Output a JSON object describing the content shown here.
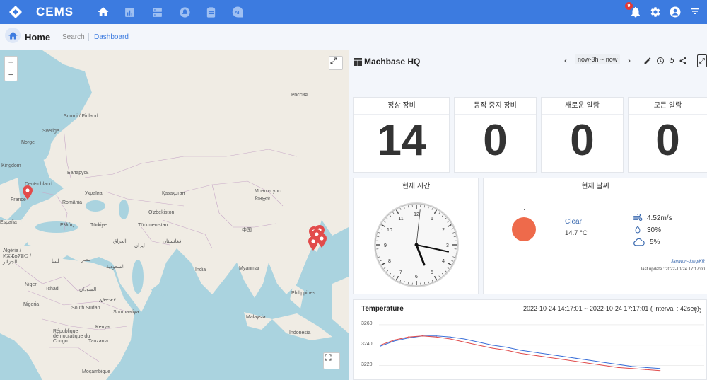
{
  "app": {
    "logo_text": "CEMS",
    "notification_count": "9"
  },
  "breadcrumb": {
    "home": "Home",
    "search": "Search",
    "dashboard": "Dashboard"
  },
  "map": {
    "zoom_in": "+",
    "zoom_out": "−",
    "labels": {
      "russia": "Россия",
      "suomi": "Suomi / Finland",
      "sverige": "Sverige",
      "norge": "Norge",
      "kingdom": "Kingdom",
      "belarus": "Беларусь",
      "deutschland": "Deutschland",
      "ukraina": "Україна",
      "france": "France",
      "romania": "România",
      "kazakhstan": "Қазақстан",
      "mongolia": "Монгол улс ᠮᠣᠩᠭᠣᠯ",
      "uzbekistan": "O'zbekiston",
      "turkiye": "Türkiye",
      "ellada": "Ελλάς",
      "turkmenistan": "Türkmenistan",
      "china": "中国",
      "espana": "España",
      "afghanistan": "افغانستان",
      "iran": "ایران",
      "iraq": "العراق",
      "algerie": "Algérie / ⵍⵣⵣⴰⵢⴻⵔ / الجزائر",
      "libya": "ليبيا",
      "egypt": "مصر",
      "saudi": "السعودية",
      "india": "India",
      "myanmar": "Myanmar",
      "philippines": "Philippines",
      "tchad": "Tchad",
      "sudan": "السودان",
      "niger": "Niger",
      "nigeria": "Nigeria",
      "ethiopia": "ኢትዮጵያ",
      "south_sudan": "South Sudan",
      "somaliland": "Soomaaliya",
      "kenya": "Kenya",
      "drc": "République démocratique du Congo",
      "tanzania": "Tanzania",
      "mocambique": "Moçambique",
      "malaysia": "Malaysia",
      "indonesia": "Indonesia"
    }
  },
  "dashboard": {
    "title": "Machbase HQ",
    "time_range": "now-3h ~ now",
    "stats": [
      {
        "label": "정상 장비",
        "value": "14"
      },
      {
        "label": "동작 중지 장비",
        "value": "0"
      },
      {
        "label": "새로운 알람",
        "value": "0"
      },
      {
        "label": "모든 알람",
        "value": "0"
      }
    ],
    "clock": {
      "title": "현재 시간",
      "hour": 5,
      "minute": 17,
      "second": 1
    },
    "weather": {
      "title": "현재 날씨",
      "condition": "Clear",
      "temperature": "14.7 °C",
      "wind": "4.52m/s",
      "humidity": "30%",
      "cloud": "5%",
      "location": "Jamwon-dong/KR",
      "last_update": "last update : 2022-10-24 17:17:00"
    },
    "temperature_chart": {
      "title": "Temperature",
      "range_text": "2022-10-24 14:17:01 ~ 2022-10-24 17:17:01 ( interval : 42sec)",
      "y_ticks": [
        "3260",
        "3240",
        "3220"
      ]
    }
  },
  "chart_data": {
    "type": "line",
    "title": "Temperature",
    "ylim": [
      3212,
      3262
    ],
    "x": [
      0,
      1,
      2,
      3,
      4,
      5,
      6,
      7,
      8,
      9,
      10,
      11,
      12,
      13,
      14,
      15,
      16,
      17,
      18,
      19,
      20
    ],
    "series": [
      {
        "color": "#3a6fd8",
        "values": [
          3239,
          3244,
          3247,
          3249,
          3249,
          3248,
          3246,
          3243,
          3240,
          3238,
          3235,
          3233,
          3231,
          3229,
          3227,
          3225,
          3223,
          3221,
          3219,
          3218,
          3217
        ]
      },
      {
        "color": "#e04a4a",
        "values": [
          3240,
          3245,
          3248,
          3249,
          3248,
          3246,
          3243,
          3240,
          3237,
          3235,
          3232,
          3230,
          3228,
          3226,
          3224,
          3222,
          3220,
          3218,
          3217,
          3216,
          3215
        ]
      }
    ]
  }
}
